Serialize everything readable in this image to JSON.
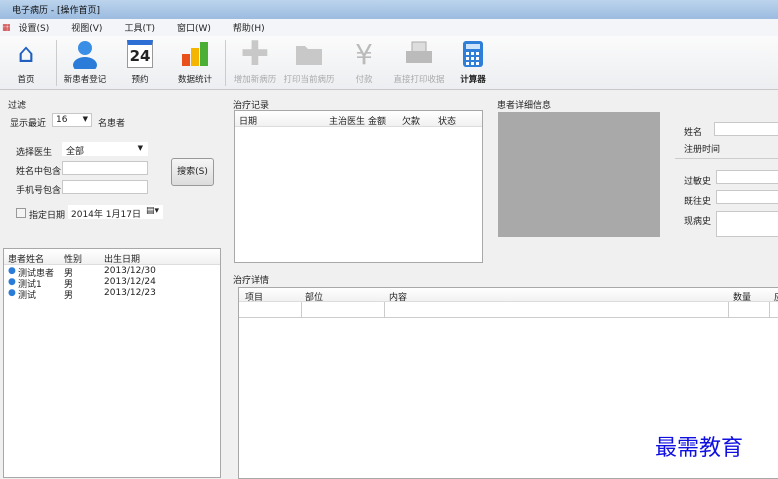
{
  "window": {
    "title": "电子病历 - [操作首页]"
  },
  "menu": [
    "设置(S)",
    "视图(V)",
    "工具(T)",
    "窗口(W)",
    "帮助(H)"
  ],
  "toolbar": [
    {
      "label": "首页",
      "icon": "home-icon",
      "enabled": true
    },
    {
      "label": "新患者登记",
      "icon": "user-icon",
      "enabled": true
    },
    {
      "label": "预约",
      "icon": "calendar-icon",
      "enabled": true,
      "day": "24"
    },
    {
      "label": "数据统计",
      "icon": "bar-chart-icon",
      "enabled": true
    },
    {
      "label": "增加新病历",
      "icon": "plus-icon",
      "enabled": false
    },
    {
      "label": "打印当前病历",
      "icon": "folder-icon",
      "enabled": false
    },
    {
      "label": "付款",
      "icon": "yen-icon",
      "enabled": false
    },
    {
      "label": "直接打印收据",
      "icon": "printer-icon",
      "enabled": false
    },
    {
      "label": "计算器",
      "icon": "calculator-icon",
      "enabled": true
    }
  ],
  "filter": {
    "title": "过滤",
    "show_recent": "显示最近",
    "recent_count": "16",
    "patients_suffix": "名患者",
    "doctor_label": "选择医生",
    "doctor_value": "全部",
    "name_label": "姓名中包含",
    "name_value": "",
    "phone_label": "手机号包含",
    "phone_value": "",
    "search_button": "搜索(S)",
    "date_label": "指定日期",
    "date_checked": false,
    "date_value": "2014年 1月17日"
  },
  "patients": {
    "columns": [
      "患者姓名",
      "性别",
      "出生日期"
    ],
    "rows": [
      [
        "测试患者",
        "男",
        "2013/12/30"
      ],
      [
        "测试1",
        "男",
        "2013/12/24"
      ],
      [
        "测试",
        "男",
        "2013/12/23"
      ]
    ]
  },
  "records": {
    "title": "治疗记录",
    "columns": [
      "日期",
      "主治医生",
      "金额",
      "欠款",
      "状态"
    ]
  },
  "detail": {
    "title": "患者详细信息",
    "name_label": "姓名",
    "reg_label": "注册时间",
    "allergy_label": "过敏史",
    "past_label": "既往史",
    "present_label": "现病史"
  },
  "treatment": {
    "title": "治疗详情",
    "columns": [
      "项目",
      "部位",
      "内容",
      "数量",
      "应"
    ]
  },
  "watermark": "最需教育",
  "colors": {
    "accent": "#1f5fbf",
    "watermark": "#1010e0"
  }
}
